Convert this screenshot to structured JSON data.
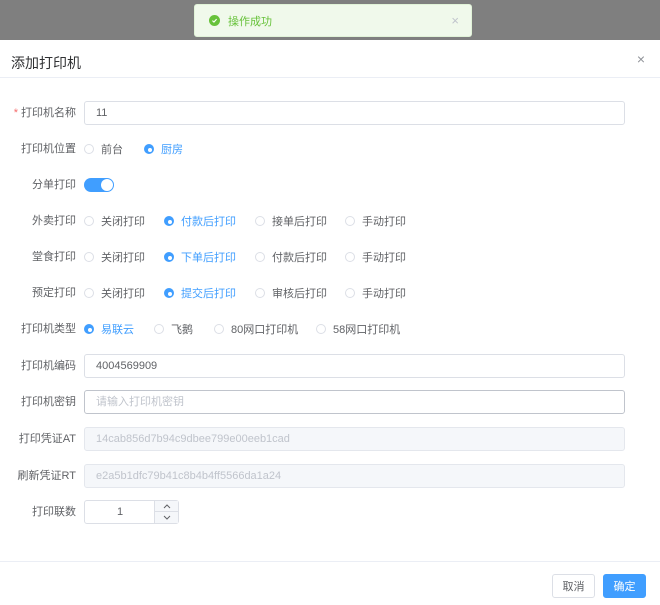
{
  "toast": {
    "message": "操作成功",
    "close": "×",
    "color": "#67c23a"
  },
  "dialog": {
    "title": "添加打印机",
    "close": "×"
  },
  "form": {
    "name": {
      "label": "打印机名称",
      "required": "*",
      "value": "11"
    },
    "position": {
      "label": "打印机位置",
      "options": [
        "前台",
        "厨房"
      ],
      "selected": "厨房"
    },
    "split": {
      "label": "分单打印",
      "enabled": true
    },
    "takeout": {
      "label": "外卖打印",
      "options": [
        "关闭打印",
        "付款后打印",
        "接单后打印",
        "手动打印"
      ],
      "selected": "付款后打印"
    },
    "dinein": {
      "label": "堂食打印",
      "options": [
        "关闭打印",
        "下单后打印",
        "付款后打印",
        "手动打印"
      ],
      "selected": "下单后打印"
    },
    "reserve": {
      "label": "预定打印",
      "options": [
        "关闭打印",
        "提交后打印",
        "审核后打印",
        "手动打印"
      ],
      "selected": "提交后打印"
    },
    "type": {
      "label": "打印机类型",
      "options": [
        "易联云",
        "飞鹅",
        "80网口打印机",
        "58网口打印机"
      ],
      "selected": "易联云"
    },
    "code": {
      "label": "打印机编码",
      "value": "4004569909"
    },
    "secret": {
      "label": "打印机密钥",
      "placeholder": "请输入打印机密钥",
      "value": ""
    },
    "at": {
      "label": "打印凭证AT",
      "value": "14cab856d7b94c9dbee799e00eeb1cad"
    },
    "rt": {
      "label": "刷新凭证RT",
      "value": "e2a5b1dfc79b41c8b4b4ff5566da1a24"
    },
    "copies": {
      "label": "打印联数",
      "value": "1"
    }
  },
  "footer": {
    "cancel": "取消",
    "confirm": "确定"
  },
  "colors": {
    "primary": "#409eff",
    "success": "#67c23a",
    "danger": "#f56c6c"
  }
}
